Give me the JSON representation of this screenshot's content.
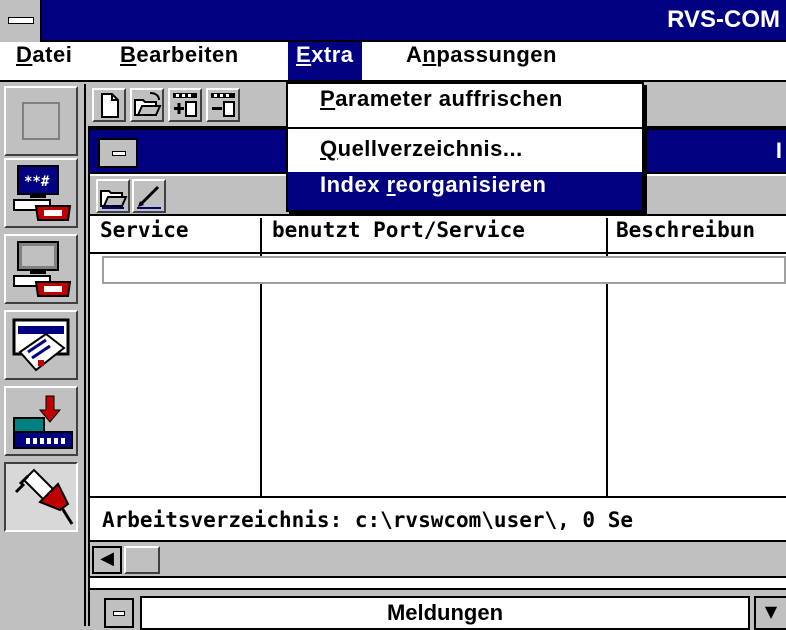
{
  "app": {
    "title": "RVS-COM"
  },
  "menubar": [
    {
      "label": "Datei",
      "underline": "D"
    },
    {
      "label": "Bearbeiten",
      "underline": "B"
    },
    {
      "label": "Extra",
      "underline": "E",
      "active": true
    },
    {
      "label": "Anpassungen",
      "underline": "n"
    }
  ],
  "dropdown": {
    "items": [
      {
        "pre": "",
        "u": "P",
        "post": "arameter auffrischen",
        "selected": false
      },
      {
        "pre": "",
        "u": "Q",
        "post": "uellverzeichnis...",
        "selected": false
      },
      {
        "pre": "Index ",
        "u": "r",
        "post": "eorganisieren",
        "selected": true
      }
    ]
  },
  "child": {
    "title": "I",
    "columns": [
      "Service",
      "benutzt Port/Service",
      "Beschreibun"
    ],
    "status_text": "Arbeitsverzeichnis: c:\\rvswcom\\user\\, 0 Se"
  },
  "messages": {
    "title": "Meldungen"
  },
  "icons": {
    "left_toolbar": [
      "blank-button-icon",
      "fax-terminal-icon",
      "computer-phone-icon",
      "fax-card-icon",
      "download-device-icon",
      "plug-connector-icon"
    ],
    "top_toolbar": [
      "new-document-icon",
      "open-folder-icon",
      "add-entry-icon",
      "remove-entry-icon"
    ],
    "child_toolbar": [
      "open-folder-icon",
      "edit-entry-icon"
    ]
  },
  "colors": {
    "titlebar": "#000080",
    "face": "#c0c0c0",
    "phone_red": "#c00000",
    "monitor_teal": "#008080"
  }
}
